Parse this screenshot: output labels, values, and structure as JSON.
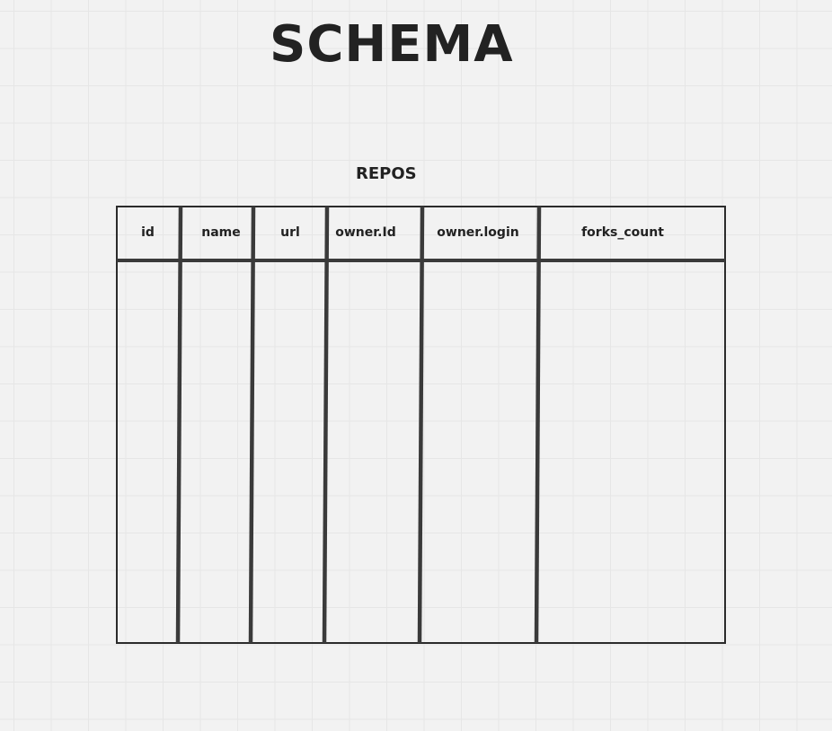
{
  "diagram": {
    "title": "SCHEMA",
    "table": {
      "name": "REPOS",
      "columns": [
        "id",
        "name",
        "url",
        "owner.Id",
        "owner.login",
        "forks_count"
      ]
    }
  }
}
